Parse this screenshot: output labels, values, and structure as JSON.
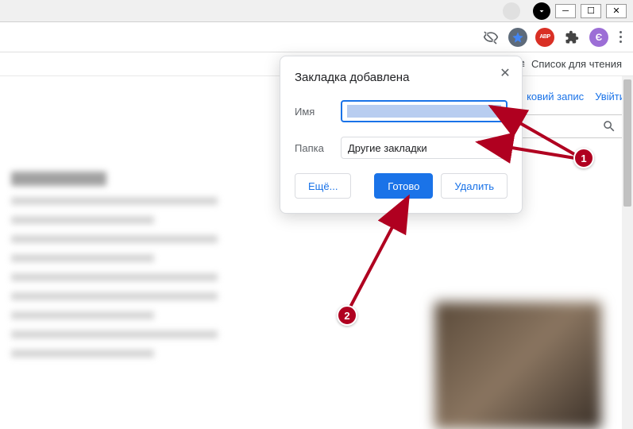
{
  "window": {
    "minimize_icon": "minimize-icon",
    "maximize_icon": "maximize-icon",
    "close_icon": "close-icon"
  },
  "toolbar": {
    "extensions": {
      "abp_label": "ABP",
      "profile_letter": "Є"
    },
    "reading_list_label": "Список для чтения"
  },
  "page": {
    "account_link": "ковий запис",
    "login_link": "Увійти"
  },
  "bookmark_dialog": {
    "title": "Закладка добавлена",
    "name_label": "Имя",
    "name_value": "",
    "folder_label": "Папка",
    "folder_value": "Другие закладки",
    "more_button": "Ещё...",
    "done_button": "Готово",
    "delete_button": "Удалить"
  },
  "annotations": {
    "badge_1": "1",
    "badge_2": "2"
  }
}
